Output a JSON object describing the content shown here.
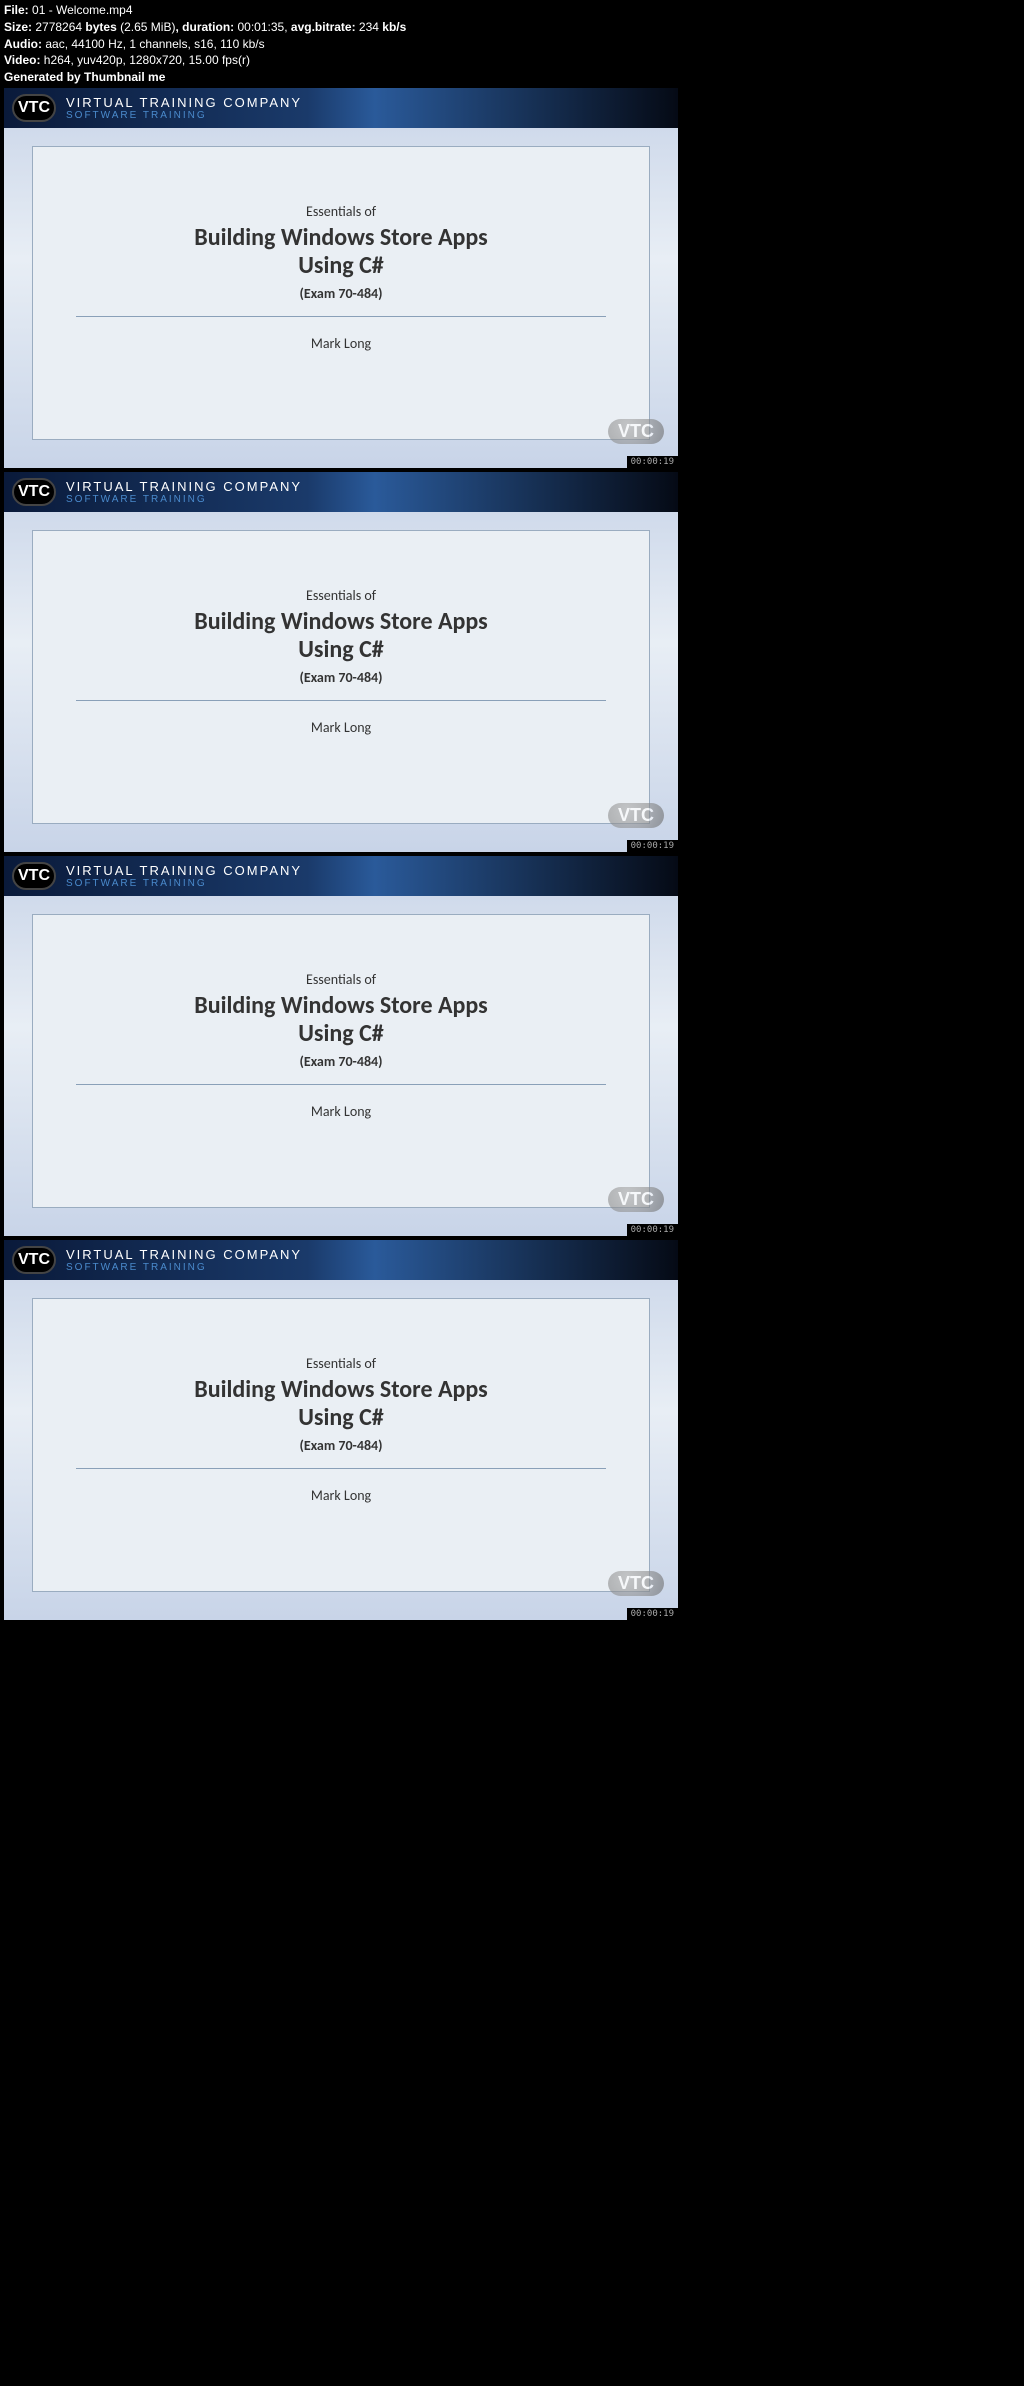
{
  "meta": {
    "file_label": "File:",
    "file_value": "01 - Welcome.mp4",
    "size_label": "Size:",
    "size_bytes": "2778264",
    "size_bytes_unit": "bytes",
    "size_mib": "(2.65 MiB)",
    "duration_label": "duration:",
    "duration_value": "00:01:35,",
    "bitrate_label": "avg.bitrate:",
    "bitrate_value": "234",
    "bitrate_unit": "kb/s",
    "audio_label": "Audio:",
    "audio_value": "aac, 44100 Hz, 1 channels, s16, 110 kb/s",
    "video_label": "Video:",
    "video_value": "h264, yuv420p, 1280x720, 15.00 fps(r)",
    "generated": "Generated by Thumbnail me"
  },
  "slide": {
    "logo_text": "VTC",
    "company": "VIRTUAL TRAINING COMPANY",
    "subtitle": "SOFTWARE TRAINING",
    "essentials": "Essentials of",
    "title_line1": "Building Windows Store Apps",
    "title_line2": "Using C#",
    "exam": "(Exam 70-484)",
    "author": "Mark Long",
    "watermark": "VTC"
  },
  "timestamps": [
    "00:00:19",
    "00:00:19",
    "00:00:19",
    "00:00:19"
  ]
}
